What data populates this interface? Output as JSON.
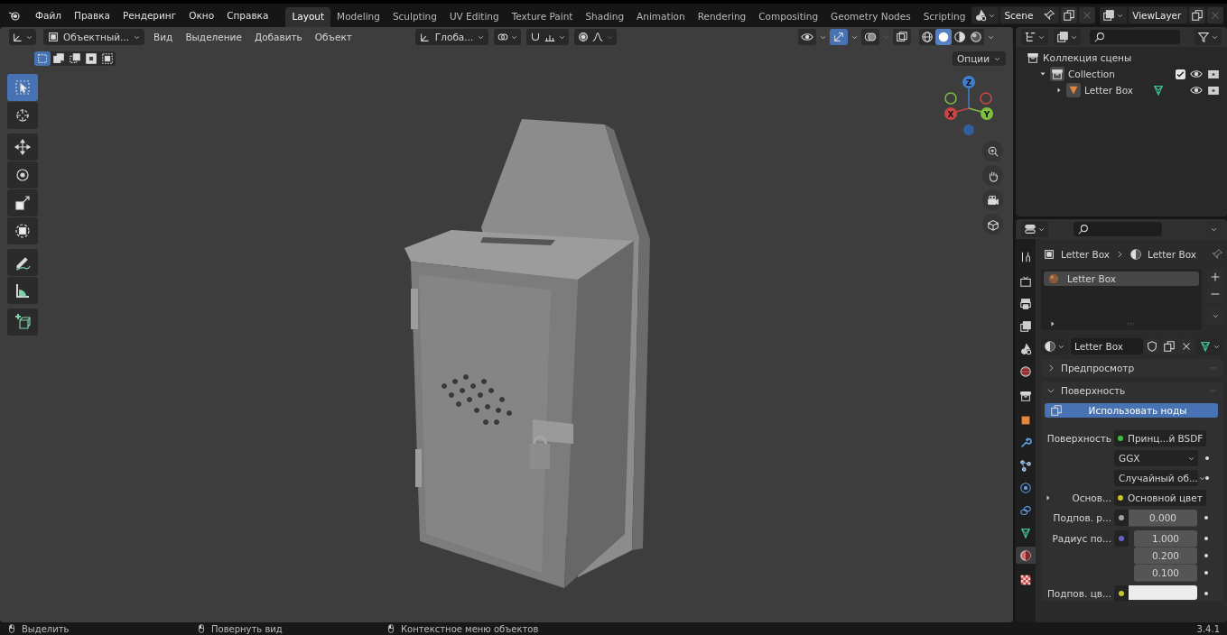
{
  "menu": [
    "Файл",
    "Правка",
    "Рендеринг",
    "Окно",
    "Справка"
  ],
  "workspaces": [
    {
      "label": "Layout",
      "selected": true
    },
    {
      "label": "Modeling",
      "selected": false
    },
    {
      "label": "Sculpting",
      "selected": false
    },
    {
      "label": "UV Editing",
      "selected": false
    },
    {
      "label": "Texture Paint",
      "selected": false
    },
    {
      "label": "Shading",
      "selected": false
    },
    {
      "label": "Animation",
      "selected": false
    },
    {
      "label": "Rendering",
      "selected": false
    },
    {
      "label": "Compositing",
      "selected": false
    },
    {
      "label": "Geometry Nodes",
      "selected": false
    },
    {
      "label": "Scripting",
      "selected": false
    }
  ],
  "scene": {
    "name": "Scene"
  },
  "view_layer": {
    "name": "ViewLayer"
  },
  "viewport": {
    "mode": "Объектный...",
    "menus": [
      "Вид",
      "Выделение",
      "Добавить",
      "Объект"
    ],
    "orientation": "Глоба...",
    "options": "Опции",
    "header_toggles": [
      {
        "kind": "visibility",
        "on": false
      },
      {
        "kind": "gizmo",
        "on": true
      },
      {
        "kind": "overlay",
        "on": false
      },
      {
        "kind": "xray",
        "on": false
      }
    ],
    "shading": [
      {
        "kind": "wireframe",
        "selected": false
      },
      {
        "kind": "solid",
        "selected": true
      },
      {
        "kind": "material",
        "selected": false
      },
      {
        "kind": "rendered",
        "selected": false
      }
    ],
    "select_modes": [
      {
        "kind": "set",
        "selected": true
      },
      {
        "kind": "extend",
        "selected": false
      },
      {
        "kind": "subtract",
        "selected": false
      },
      {
        "kind": "invert",
        "selected": false
      },
      {
        "kind": "intersect",
        "selected": false
      }
    ],
    "tool_groups": [
      [
        {
          "kind": "select",
          "selected": true
        },
        {
          "kind": "cursor",
          "selected": false
        }
      ],
      [
        {
          "kind": "move",
          "selected": false
        },
        {
          "kind": "rotate",
          "selected": false
        },
        {
          "kind": "scale",
          "selected": false
        },
        {
          "kind": "transform",
          "selected": false
        }
      ],
      [
        {
          "kind": "annotate",
          "selected": false
        },
        {
          "kind": "measure",
          "selected": false
        }
      ],
      [
        {
          "kind": "add-cube",
          "selected": false
        }
      ]
    ],
    "gizmo_axes": [
      "X",
      "Y",
      "Z"
    ],
    "nav": [
      {
        "kind": "zoom"
      },
      {
        "kind": "pan"
      },
      {
        "kind": "camera"
      },
      {
        "kind": "ortho"
      }
    ],
    "scene_content": {
      "kind": "picture"
    }
  },
  "outliner": {
    "tree": [
      {
        "label": "Коллекция сцены",
        "kind": "scene-collection",
        "children": [
          {
            "label": "Collection",
            "kind": "collection",
            "expanded": true,
            "checked": true,
            "children": [
              {
                "label": "Letter Box",
                "kind": "object",
                "expanded": false
              }
            ]
          }
        ]
      }
    ]
  },
  "properties": {
    "tab_groups": [
      [
        {
          "kind": "tool",
          "selected": false
        }
      ],
      [
        {
          "kind": "render",
          "selected": false
        },
        {
          "kind": "output",
          "selected": false
        },
        {
          "kind": "view-layer",
          "selected": false
        },
        {
          "kind": "scene",
          "selected": false
        },
        {
          "kind": "world",
          "selected": false
        }
      ],
      [
        {
          "kind": "collection",
          "selected": false
        }
      ],
      [
        {
          "kind": "object",
          "selected": false
        },
        {
          "kind": "modifiers",
          "selected": false
        },
        {
          "kind": "particles",
          "selected": false
        },
        {
          "kind": "physics",
          "selected": false
        },
        {
          "kind": "constraints",
          "selected": false
        },
        {
          "kind": "data",
          "selected": false
        },
        {
          "kind": "material",
          "selected": true
        }
      ],
      [
        {
          "kind": "texture",
          "selected": false
        }
      ]
    ],
    "breadcrumb": [
      "Letter Box",
      "Letter Box"
    ],
    "slots": [
      {
        "name": "Letter Box",
        "selected": true
      }
    ],
    "material": "Letter Box",
    "panels": [
      {
        "title": "Предпросмотр",
        "expanded": false
      },
      {
        "title": "Поверхность",
        "expanded": true,
        "button": "Использовать ноды",
        "rows": [
          {
            "kind": "link",
            "label": "Поверхность",
            "value": "Принц...й BSDF",
            "color": "#3fbf3f"
          },
          {
            "kind": "dropdown",
            "value": "GGX"
          },
          {
            "kind": "dropdown",
            "value": "Случайный об..."
          },
          {
            "kind": "link",
            "label": "Основ...",
            "value": "Основной цвет",
            "color": "#c7c729",
            "expanded": false
          },
          {
            "kind": "number",
            "label": "Подпов. р...",
            "values": [
              "0.000"
            ],
            "color": "#a1a1a1"
          },
          {
            "kind": "number",
            "label": "Радиус по...",
            "values": [
              "1.000",
              "0.200",
              "0.100"
            ],
            "color": "#6363c7"
          },
          {
            "kind": "swatch",
            "label": "Подпов. цв...",
            "color": "#c7c729"
          }
        ]
      }
    ]
  },
  "status_bar": {
    "hints": [
      "Выделить",
      "Повернуть вид",
      "Контекстное меню объектов"
    ],
    "version": "3.4.1"
  }
}
